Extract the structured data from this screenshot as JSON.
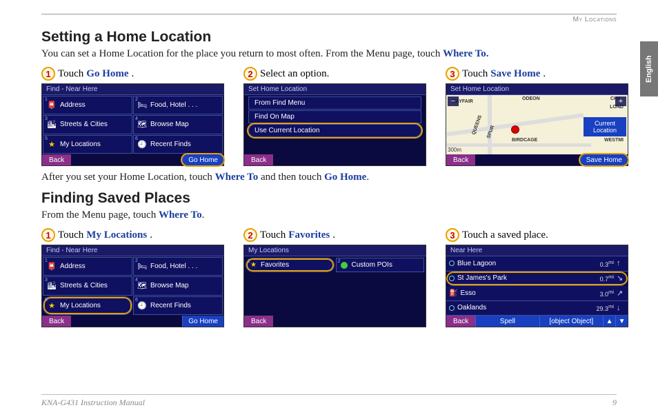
{
  "header": {
    "section": "My Locations"
  },
  "lang_tab": "English",
  "section1": {
    "title": "Setting a Home Location",
    "intro_a": "You can set a Home Location for the place you return to most often. From the Menu page, touch ",
    "intro_link": "Where To.",
    "step1": {
      "num": "1",
      "pre": " Touch ",
      "link": "Go Home",
      "post": "."
    },
    "step2": {
      "num": "2",
      "text": " Select an option."
    },
    "step3": {
      "num": "3",
      "pre": " Touch ",
      "link": "Save Home",
      "post": "."
    },
    "after_a": "After you set your Home Location, touch ",
    "after_link1": "Where To",
    "after_b": " and then touch ",
    "after_link2": "Go Home",
    "after_c": "."
  },
  "section2": {
    "title": "Finding Saved Places",
    "intro_a": "From the Menu page, touch ",
    "intro_link": "Where To",
    "intro_b": ".",
    "step1": {
      "num": "1",
      "pre": " Touch ",
      "link": "My Locations",
      "post": "."
    },
    "step2": {
      "num": "2",
      "pre": " Touch ",
      "link": "Favorites",
      "post": "."
    },
    "step3": {
      "num": "3",
      "text": " Touch a saved place."
    }
  },
  "ss": {
    "find_title": "Find - Near Here",
    "set_home_title": "Set Home Location",
    "my_locations_title": "My Locations",
    "near_here_title": "Near Here",
    "back": "Back",
    "go_home": "Go Home",
    "save_home": "Save Home",
    "spell": "Spell",
    "near": {
      "r1": {
        "name": "Blue Lagoon",
        "dist": "0.3",
        "unit": "mi"
      },
      "r2": {
        "name": "St James's Park",
        "dist": "0.7",
        "unit": "mi"
      },
      "r3": {
        "name": "Esso",
        "dist": "3.0",
        "unit": "mi"
      },
      "r4": {
        "name": "Oaklands",
        "dist": "29.3",
        "unit": "mi"
      }
    },
    "tiles": {
      "t1": "Address",
      "t2": "Food, Hotel . . .",
      "t3": "Streets & Cities",
      "t4": "Browse Map",
      "t5": "My Locations",
      "t6": "Recent Finds"
    },
    "nums": {
      "n1": "1",
      "n2": "2",
      "n3": "3",
      "n4": "4",
      "n5": "5",
      "n6": "6"
    },
    "options": {
      "o1": "From Find Menu",
      "o2": "Find On Map",
      "o3": "Use Current Location"
    },
    "map": {
      "l1": "MAYFAIR",
      "l2": "ODEON",
      "l3": "CHA",
      "l4": "LOND",
      "l5": "BIRDCAGE",
      "l6": "WESTMI",
      "l7": "QUEENS",
      "l8": "SPUR",
      "scale": "300m",
      "curloc": "Current Location",
      "minus": "−",
      "plus": "+"
    },
    "fav": {
      "f1": "Favorites",
      "f2": "Custom POIs"
    }
  },
  "footer": {
    "manual": "KNA-G431 Instruction Manual",
    "page": "9"
  }
}
